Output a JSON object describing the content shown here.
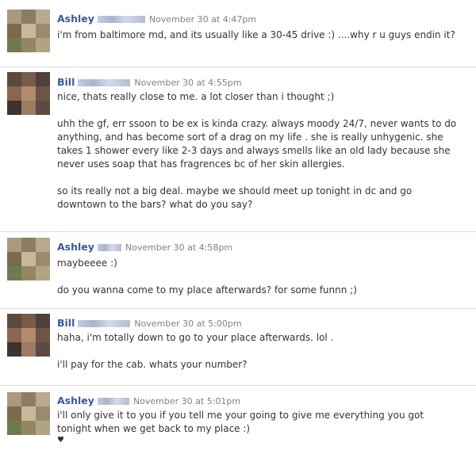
{
  "messages": [
    {
      "author": "Ashley",
      "time": "November 30 at 4:47pm",
      "paragraphs": [
        "i'm from baltimore md, and its usually like a 30-45 drive :) ....why r u guys endin it?"
      ]
    },
    {
      "author": "Bill",
      "time": "November 30 at 4:55pm",
      "paragraphs": [
        "nice, thats really close to me. a lot closer than i thought ;)",
        "uhh the gf, err ssoon to be ex is kinda crazy. always moody 24/7, never wants to do anything, and has become sort of a drag on my life . she is really unhygenic. she takes 1 shower every like 2-3 days and always smells like an old lady because she never uses soap that has fragrences bc of her skin allergies.",
        "so its really not a big deal. maybe we should meet up tonight in dc and go downtown to the bars? what do you say?"
      ]
    },
    {
      "author": "Ashley",
      "time": "November 30 at 4:58pm",
      "paragraphs": [
        "maybeeee :)",
        "do you wanna come to my place afterwards? for some funnn ;)"
      ]
    },
    {
      "author": "Bill",
      "time": "November 30 at 5:00pm",
      "paragraphs": [
        "haha, i'm totally down to go to your place afterwards. lol .",
        "i'll pay for the cab. whats your number?"
      ]
    },
    {
      "author": "Ashley",
      "time": "November 30 at 5:01pm",
      "paragraphs": [
        "i'll only give it to you if you tell me your going to give me everything you got tonight when we get back to my place :)"
      ],
      "heart": "♥"
    }
  ]
}
